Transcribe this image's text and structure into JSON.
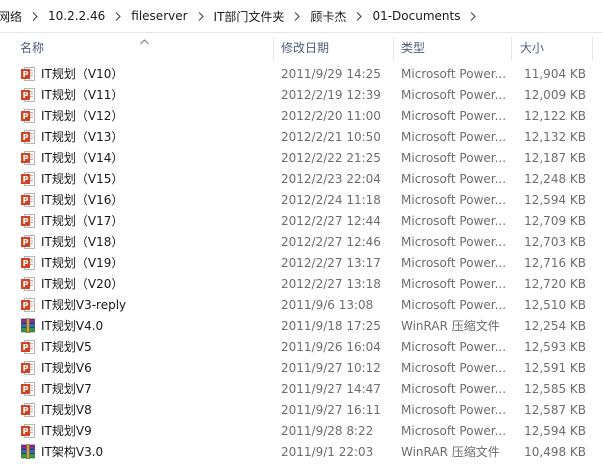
{
  "breadcrumb": {
    "items": [
      "网络",
      "10.2.2.46",
      "fileserver",
      "IT部门文件夹",
      "顾卡杰",
      "01-Documents"
    ]
  },
  "columns": {
    "name": "名称",
    "date": "修改日期",
    "type": "类型",
    "size": "大小"
  },
  "files": [
    {
      "name": "IT规划（V10）",
      "date": "2011/9/29 14:25",
      "type": "Microsoft Power...",
      "size": "11,904 KB",
      "icon": "powerpoint-file-icon"
    },
    {
      "name": "IT规划（V11）",
      "date": "2012/2/19 12:39",
      "type": "Microsoft Power...",
      "size": "12,009 KB",
      "icon": "powerpoint-file-icon"
    },
    {
      "name": "IT规划（V12）",
      "date": "2012/2/20 11:00",
      "type": "Microsoft Power...",
      "size": "12,122 KB",
      "icon": "powerpoint-file-icon"
    },
    {
      "name": "IT规划（V13）",
      "date": "2012/2/21 10:50",
      "type": "Microsoft Power...",
      "size": "12,132 KB",
      "icon": "powerpoint-file-icon"
    },
    {
      "name": "IT规划（V14）",
      "date": "2012/2/22 21:25",
      "type": "Microsoft Power...",
      "size": "12,187 KB",
      "icon": "powerpoint-file-icon"
    },
    {
      "name": "IT规划（V15）",
      "date": "2012/2/23 22:04",
      "type": "Microsoft Power...",
      "size": "12,248 KB",
      "icon": "powerpoint-file-icon"
    },
    {
      "name": "IT规划（V16）",
      "date": "2012/2/24 11:18",
      "type": "Microsoft Power...",
      "size": "12,594 KB",
      "icon": "powerpoint-file-icon"
    },
    {
      "name": "IT规划（V17）",
      "date": "2012/2/27 12:44",
      "type": "Microsoft Power...",
      "size": "12,709 KB",
      "icon": "powerpoint-file-icon"
    },
    {
      "name": "IT规划（V18）",
      "date": "2012/2/27 12:46",
      "type": "Microsoft Power...",
      "size": "12,703 KB",
      "icon": "powerpoint-file-icon"
    },
    {
      "name": "IT规划（V19）",
      "date": "2012/2/27 13:17",
      "type": "Microsoft Power...",
      "size": "12,716 KB",
      "icon": "powerpoint-file-icon"
    },
    {
      "name": "IT规划（V20）",
      "date": "2012/2/27 13:18",
      "type": "Microsoft Power...",
      "size": "12,720 KB",
      "icon": "powerpoint-file-icon"
    },
    {
      "name": "IT规划V3-reply",
      "date": "2011/9/6 13:08",
      "type": "Microsoft Power...",
      "size": "12,510 KB",
      "icon": "powerpoint-file-icon"
    },
    {
      "name": "IT规划V4.0",
      "date": "2011/9/18 17:25",
      "type": "WinRAR 压缩文件",
      "size": "12,254 KB",
      "icon": "winrar-archive-icon"
    },
    {
      "name": "IT规划V5",
      "date": "2011/9/26 16:04",
      "type": "Microsoft Power...",
      "size": "12,593 KB",
      "icon": "powerpoint-file-icon"
    },
    {
      "name": "IT规划V6",
      "date": "2011/9/27 10:12",
      "type": "Microsoft Power...",
      "size": "12,591 KB",
      "icon": "powerpoint-file-icon"
    },
    {
      "name": "IT规划V7",
      "date": "2011/9/27 14:47",
      "type": "Microsoft Power...",
      "size": "12,585 KB",
      "icon": "powerpoint-file-icon"
    },
    {
      "name": "IT规划V8",
      "date": "2011/9/27 16:11",
      "type": "Microsoft Power...",
      "size": "12,587 KB",
      "icon": "powerpoint-file-icon"
    },
    {
      "name": "IT规划V9",
      "date": "2011/9/28 8:22",
      "type": "Microsoft Power...",
      "size": "12,594 KB",
      "icon": "powerpoint-file-icon"
    },
    {
      "name": "IT架构V3.0",
      "date": "2011/9/1 22:03",
      "type": "WinRAR 压缩文件",
      "size": "10,498 KB",
      "icon": "winrar-archive-icon"
    }
  ],
  "colors": {
    "header_text": "#4c607a",
    "detail_text": "#6d6d6d",
    "powerpoint_red": "#d04423"
  }
}
